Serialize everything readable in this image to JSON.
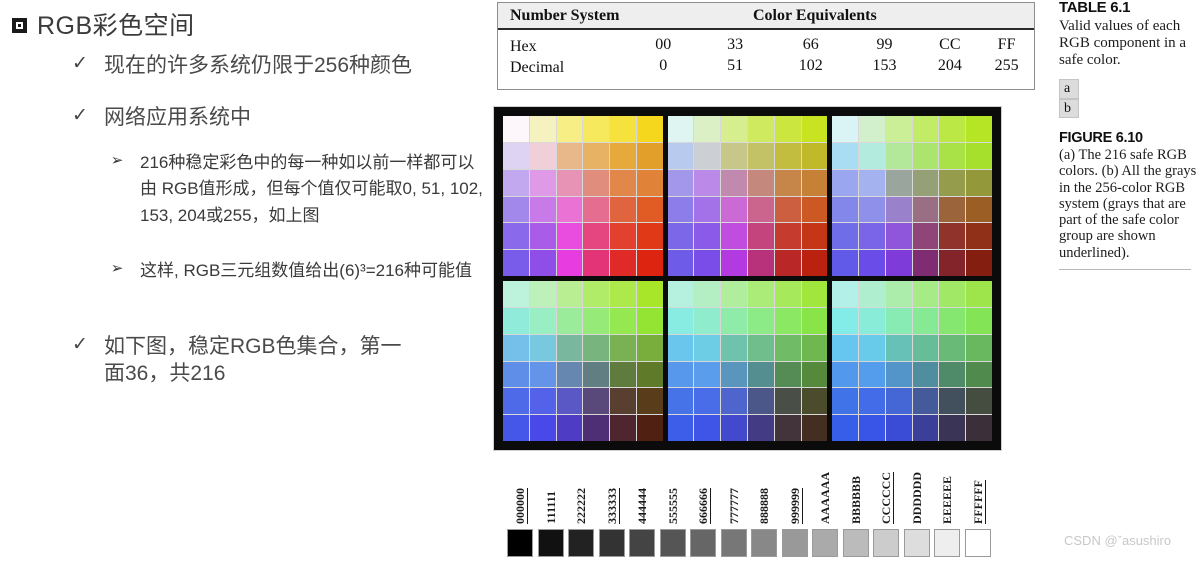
{
  "slide": {
    "title": "RGB彩色空间",
    "bullets": [
      {
        "level": 1,
        "marker": "✓",
        "text": "现在的许多系统仍限于256种颜色"
      },
      {
        "level": 1,
        "marker": "✓",
        "text": "网络应用系统中"
      },
      {
        "level": 2,
        "marker": "➢",
        "text": "216种稳定彩色中的每一种如以前一样都可以由 RGB值形成，但每个值仅可能取0, 51, 102, 153, 204或255，如上图"
      },
      {
        "level": 2,
        "marker": "➢",
        "text": "这样, RGB三元组数值给出(6)³=216种可能值"
      },
      {
        "level": 1,
        "marker": "✓",
        "text": "如下图，稳定RGB色集合，第一面36，共216"
      }
    ]
  },
  "table": {
    "caption_label": "TABLE 6.1",
    "header_left": "Number System",
    "header_center": "Color Equivalents",
    "rows": [
      {
        "label": "Hex",
        "values": [
          "00",
          "33",
          "66",
          "99",
          "CC",
          "FF"
        ]
      },
      {
        "label": "Decimal",
        "values": [
          "0",
          "51",
          "102",
          "153",
          "204",
          "255"
        ]
      }
    ]
  },
  "figure_caption": {
    "table_title": "TABLE 6.1",
    "table_body": "Valid values of each RGB component in a safe color.",
    "ab_labels": [
      "a",
      "b"
    ],
    "figure_title": "FIGURE 6.10",
    "figure_body": "(a) The 216 safe RGB colors. (b) All the grays in the 256-color RGB system (grays that are part of the safe color group are shown underlined)."
  },
  "grayscale": {
    "labels": [
      {
        "text": "000000",
        "underlined": true
      },
      {
        "text": "111111",
        "underlined": false
      },
      {
        "text": "222222",
        "underlined": false
      },
      {
        "text": "333333",
        "underlined": true
      },
      {
        "text": "444444",
        "underlined": false
      },
      {
        "text": "555555",
        "underlined": false
      },
      {
        "text": "666666",
        "underlined": true
      },
      {
        "text": "777777",
        "underlined": false
      },
      {
        "text": "888888",
        "underlined": false
      },
      {
        "text": "999999",
        "underlined": true
      },
      {
        "text": "AAAAAA",
        "underlined": false
      },
      {
        "text": "BBBBBB",
        "underlined": false
      },
      {
        "text": "CCCCCC",
        "underlined": true
      },
      {
        "text": "DDDDDD",
        "underlined": false
      },
      {
        "text": "EEEEEE",
        "underlined": false
      },
      {
        "text": "FFFFFF",
        "underlined": true
      }
    ],
    "swatches": [
      "#000000",
      "#111111",
      "#222222",
      "#333333",
      "#444444",
      "#555555",
      "#666666",
      "#777777",
      "#888888",
      "#999999",
      "#AAAAAA",
      "#BBBBBB",
      "#CCCCCC",
      "#DDDDDD",
      "#EEEEEE",
      "#FFFFFF"
    ]
  },
  "chart_data": {
    "type": "heatmap",
    "title": "The 216 safe RGB colors",
    "levels": [
      255,
      204,
      153,
      102,
      51,
      0
    ],
    "level_hex": [
      "FF",
      "CC",
      "99",
      "66",
      "33",
      "00"
    ],
    "note": "6 blocks of 6x6; block index = blue level; columns = red level, rows = green level",
    "blocks": [
      {
        "blue": 255,
        "cells": [
          [
            "#ffffff",
            "#ffccff",
            "#ff99ff",
            "#ff66ff",
            "#ff33ff",
            "#ff00ff"
          ],
          [
            "#ccccff",
            "#cc99ff",
            "#cc66ff",
            "#cc33ff",
            "#cc00ff",
            "#cc00ff"
          ],
          [
            "#9999ff",
            "#9966ff",
            "#9933ff",
            "#9900ff",
            "#9900ff",
            "#9900ff"
          ],
          [
            "#6666ff",
            "#6633ff",
            "#6600ff",
            "#6600ff",
            "#6600ff",
            "#6600ff"
          ],
          [
            "#3333ff",
            "#3300ff",
            "#3300ff",
            "#3300ff",
            "#3300ff",
            "#3300ff"
          ],
          [
            "#0000ff",
            "#0000ff",
            "#0000ff",
            "#0000ff",
            "#0000ff",
            "#0000ff"
          ]
        ]
      },
      {
        "blue": 204,
        "cells": []
      },
      {
        "blue": 153,
        "cells": []
      },
      {
        "blue": 102,
        "cells": []
      },
      {
        "blue": 51,
        "cells": []
      },
      {
        "blue": 0,
        "cells": []
      }
    ],
    "rendered_blocks": [
      [
        [
          "#fdf6fa",
          "#f6f2c0",
          "#f7ee86",
          "#f7e95d",
          "#f6e23c",
          "#f5d71d"
        ],
        [
          "#dfd3f4",
          "#f0cfd8",
          "#e8b88a",
          "#e8b264",
          "#e5a93c",
          "#e2a02b"
        ],
        [
          "#c2a9ef",
          "#de9ae6",
          "#e793b6",
          "#e08d7e",
          "#e08749",
          "#e08238"
        ],
        [
          "#a388ec",
          "#c77ae8",
          "#ea72d4",
          "#e56e90",
          "#e0653f",
          "#e05c24"
        ],
        [
          "#8a6aea",
          "#a85ce8",
          "#e84de0",
          "#e6467f",
          "#e3412f",
          "#e03918"
        ],
        [
          "#7a5cea",
          "#8f4ee8",
          "#e63ce0",
          "#e43478",
          "#e02a28",
          "#dd2410"
        ]
      ],
      [
        [
          "#dff5f2",
          "#dcf0c6",
          "#d6ee8e",
          "#d0ea60",
          "#cbe63f",
          "#c8e31f"
        ],
        [
          "#b8cbef",
          "#ccd0d4",
          "#c8c78a",
          "#c4c266",
          "#c2bd3f",
          "#c0ba2a"
        ],
        [
          "#a397ec",
          "#bb8ae9",
          "#c189ad",
          "#c4897c",
          "#c68549",
          "#c78137"
        ],
        [
          "#8d7dea",
          "#a472e8",
          "#cb6ad4",
          "#cb658e",
          "#cb5f3f",
          "#cc5924"
        ],
        [
          "#7c67e8",
          "#8b5ae8",
          "#c04ce0",
          "#c4447e",
          "#c53c2e",
          "#c53617"
        ],
        [
          "#6e5be8",
          "#7a4de8",
          "#b23ae0",
          "#b7327a",
          "#ba2727",
          "#bb210f"
        ]
      ],
      [
        [
          "#daf3f4",
          "#d3f0cc",
          "#cbef96",
          "#c2eb66",
          "#bbe844",
          "#b5e525"
        ],
        [
          "#a8ddf4",
          "#b4ebdf",
          "#b3e79a",
          "#abe56e",
          "#a9e247",
          "#a6e02d"
        ],
        [
          "#9aa6ef",
          "#a4b3ef",
          "#9aa59e",
          "#96a077",
          "#959c4b",
          "#93993a"
        ],
        [
          "#8387ea",
          "#8f90e9",
          "#9a81cc",
          "#9a6f84",
          "#9b643b",
          "#9b5f26"
        ],
        [
          "#6f6ee8",
          "#7a65e8",
          "#8f55db",
          "#8f4577",
          "#90332b",
          "#903018"
        ],
        [
          "#6159e8",
          "#6a4ce8",
          "#7f3ada",
          "#802c73",
          "#822429",
          "#831e11"
        ]
      ],
      [
        [
          "#bdf2dd",
          "#bdf1b9",
          "#b9ef92",
          "#b1ec69",
          "#ade94a",
          "#a8e62a"
        ],
        [
          "#90ebdb",
          "#9aeec4",
          "#9aec9a",
          "#96ea77",
          "#96e851",
          "#94e533"
        ],
        [
          "#75c0ea",
          "#78c8df",
          "#79b89e",
          "#78b47d",
          "#79b153",
          "#79ae3c"
        ],
        [
          "#5f8ee8",
          "#6494e8",
          "#6688b0",
          "#617e82",
          "#5f7b3d",
          "#5f7a28"
        ],
        [
          "#4e6ae8",
          "#5362e8",
          "#5a58c4",
          "#58497a",
          "#583f2f",
          "#593c19"
        ],
        [
          "#4457e8",
          "#4849e8",
          "#4e3cc4",
          "#4e2f76",
          "#4f2630",
          "#502013"
        ]
      ],
      [
        [
          "#b6f1e0",
          "#b4efc4",
          "#b0ee9d",
          "#aaec77",
          "#a6e95a",
          "#a1e63d"
        ],
        [
          "#88ece2",
          "#8fedce",
          "#8eeca8",
          "#8cea87",
          "#8be862",
          "#89e547"
        ],
        [
          "#6bc6ee",
          "#6dcde5",
          "#6fc2ab",
          "#6fbe8b",
          "#6fbb66",
          "#6fb850"
        ],
        [
          "#5798ec",
          "#5a9dec",
          "#5a95bd",
          "#558e91",
          "#558b55",
          "#558a3c"
        ],
        [
          "#4773e8",
          "#496ce8",
          "#4d65cd",
          "#4b5789",
          "#494e46",
          "#4a4c2c"
        ],
        [
          "#3c5ee8",
          "#3f55e8",
          "#4349cd",
          "#433c85",
          "#43333b",
          "#442e22"
        ]
      ],
      [
        [
          "#b3f0e8",
          "#b0eed0",
          "#acedab",
          "#a6eb85",
          "#a2e867",
          "#9de54b"
        ],
        [
          "#83ece8",
          "#88ecd8",
          "#88ebb4",
          "#86e994",
          "#85e770",
          "#83e456"
        ],
        [
          "#66c6ef",
          "#68cbe9",
          "#68c1b7",
          "#68bd99",
          "#68ba76",
          "#69b75f"
        ],
        [
          "#5298ed",
          "#549cec",
          "#5395c8",
          "#508e9f",
          "#4f8b68",
          "#508a4d"
        ],
        [
          "#4173e8",
          "#436ce8",
          "#4467d5",
          "#455a9b",
          "#424f5c",
          "#444d40"
        ],
        [
          "#365ee8",
          "#3955e8",
          "#3a4bd6",
          "#3b3f99",
          "#3a3556",
          "#3b303a"
        ]
      ]
    ]
  },
  "watermark": "CSDN @ˇasushiro"
}
